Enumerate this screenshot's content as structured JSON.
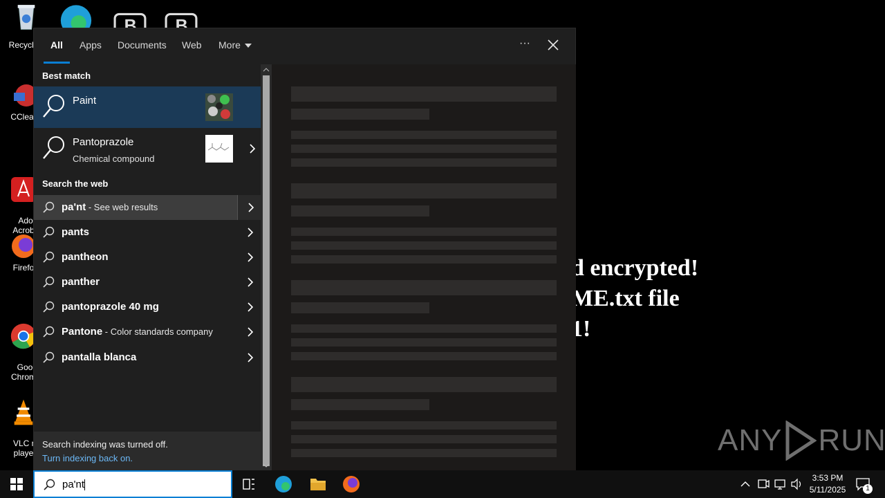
{
  "desktop": {
    "icons": [
      {
        "label": "Recycle"
      },
      {
        "label": "CClear"
      },
      {
        "label": "Adob\nAcrob"
      },
      {
        "label": "Firefo"
      },
      {
        "label": "Googl\nChrom"
      },
      {
        "label": "VLC me\nplaye"
      }
    ],
    "ransom_lines": "d encrypted!\nME.txt file\n1!",
    "watermark": {
      "left": "ANY",
      "right": "RUN"
    }
  },
  "search_panel": {
    "tabs": [
      {
        "label": "All",
        "active": true
      },
      {
        "label": "Apps"
      },
      {
        "label": "Documents"
      },
      {
        "label": "Web"
      },
      {
        "label": "More"
      }
    ],
    "options_label": "···",
    "best_match": {
      "heading": "Best match",
      "items": [
        {
          "title": "Paint",
          "subtitle": "",
          "selected": true
        },
        {
          "title": "Pantoprazole",
          "subtitle": "Chemical compound"
        }
      ]
    },
    "search_web": {
      "heading": "Search the web",
      "items": [
        {
          "bold": "pa'nt",
          "muted": " - See web results",
          "highlighted": true
        },
        {
          "bold": "pants",
          "muted": ""
        },
        {
          "bold": "pantheon",
          "muted": ""
        },
        {
          "bold": "panther",
          "muted": ""
        },
        {
          "bold": "pantoprazole 40 mg",
          "muted": ""
        },
        {
          "bold": "Pantone",
          "muted": " - Color standards company"
        },
        {
          "bold": "pantalla blanca",
          "muted": ""
        }
      ]
    },
    "indexing": {
      "message": "Search indexing was turned off.",
      "link": "Turn indexing back on."
    }
  },
  "taskbar": {
    "search_value": "pa'nt",
    "clock_time": "3:53 PM",
    "clock_date": "5/11/2025",
    "notification_count": "1"
  },
  "colors": {
    "accent": "#0a7fd4",
    "selected_bg": "#1b3a57",
    "link": "#6cb8f6"
  }
}
